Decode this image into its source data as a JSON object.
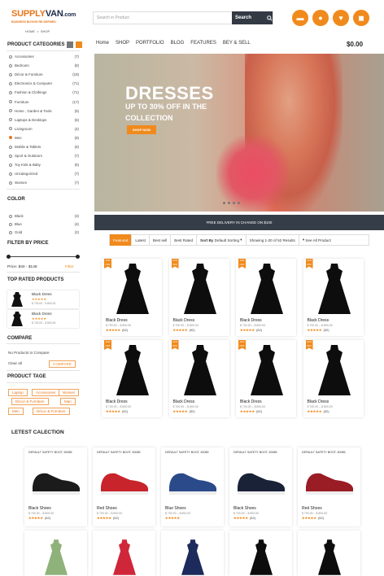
{
  "brand": {
    "name_a": "SUPPLY",
    "name_b": "VAN",
    "tld": ".com",
    "tagline": "BUSINESS BUYING RE-DEFINED"
  },
  "breadcrumb": {
    "home": "HOME",
    "sep": ">",
    "current": "SHOP"
  },
  "search": {
    "placeholder": "Search in Product",
    "button": "Search"
  },
  "nav": {
    "items": [
      "Home",
      "SHOP",
      "PORTFOLIO",
      "BLOG",
      "FEATURES",
      "BEY & SELL"
    ],
    "cart": "$0.00"
  },
  "sidebar": {
    "categories_title": "PRODUCT CATEGORIES",
    "categories": [
      {
        "label": "Accessories",
        "count": "(7)"
      },
      {
        "label": "Bedroom",
        "count": "(8)"
      },
      {
        "label": "Décor & Furniture",
        "count": "(18)"
      },
      {
        "label": "Electronics & Computer",
        "count": "(71)"
      },
      {
        "label": "Fashion & Clothings",
        "count": "(71)"
      },
      {
        "label": "Furniture",
        "count": "(17)"
      },
      {
        "label": "Home , Garden & Tools",
        "count": "(5)"
      },
      {
        "label": "Laptops & Desktops",
        "count": "(6)"
      },
      {
        "label": "Livingroom",
        "count": "(4)"
      },
      {
        "label": "Men",
        "count": "(8)"
      },
      {
        "label": "Mobile & Tablets",
        "count": "(6)"
      },
      {
        "label": "Sport & Outdoors",
        "count": "(7)"
      },
      {
        "label": "Toy Kids & Baby",
        "count": "(6)"
      },
      {
        "label": "Uncategorized",
        "count": "(7)"
      },
      {
        "label": "Women",
        "count": "(7)"
      }
    ],
    "color_title": "COLOR",
    "colors": [
      {
        "label": "Black",
        "count": "(3)"
      },
      {
        "label": "Blue",
        "count": "(4)"
      },
      {
        "label": "Gold",
        "count": "(2)"
      }
    ],
    "price_title": "FILTER BY PRICE",
    "price_range": "Price: $40 - $148",
    "filter_btn": "Filter",
    "top_rated_title": "TOP RATED PRODUCTS",
    "top_rated": [
      {
        "name": "Black Dress",
        "stars": "★★★★★",
        "price": "$ 700.00 - $ 800.00"
      },
      {
        "name": "Black Dress",
        "stars": "★★★★★",
        "price": "$ 700.00 - $ 800.00"
      }
    ],
    "compare_title": "COMPARE",
    "compare_empty": "No Products to Compare",
    "clear_all": "Clear all",
    "compare_btn": "COMPARE",
    "tags_title": "PRODUCT TAGE",
    "tags": [
      "Laptop",
      "Accessories",
      "Women",
      "Décor & Furniture",
      "Man",
      "Men",
      "Décor & Furniture"
    ]
  },
  "hero": {
    "title": "DRESSES",
    "line1": "UP TO 30% OFF IN THE",
    "line2": "COLLECTION",
    "button": "SHOP NOW"
  },
  "banner": "FREE DELIVERY IN CHANGE ON $100",
  "sortbar": {
    "tabs": [
      "Featured",
      "Latest",
      "Best sell",
      "Best Rated"
    ],
    "sort_label": "Sort By",
    "sort_value": "Default Sorting",
    "results": "Showing 1-20 of 52 Results",
    "see_all": "See All Product"
  },
  "products": [
    {
      "badge": "12% OFF",
      "name": "Black Dress",
      "price": "$ 700.00 – $ 800.00",
      "stars": "★★★★★",
      "reviews": "(52)"
    },
    {
      "badge": "12% OFF",
      "name": "Black Dress",
      "price": "$ 700.00 – $ 800.00",
      "stars": "★★★★★",
      "reviews": "(52)"
    },
    {
      "badge": "12% OFF",
      "name": "Black Dress",
      "price": "$ 700.00 – $ 800.00",
      "stars": "★★★★★",
      "reviews": "(52)"
    },
    {
      "badge": "12% OFF",
      "name": "Black Dress",
      "price": "$ 700.00 – $ 800.00",
      "stars": "★★★★★",
      "reviews": "(52)"
    },
    {
      "badge": "12% OFF",
      "name": "Black Dress",
      "price": "$ 700.00 – $ 800.00",
      "stars": "★★★★★",
      "reviews": "(52)"
    },
    {
      "badge": "12% OFF",
      "name": "Black Dress",
      "price": "$ 700.00 – $ 800.00",
      "stars": "★★★★★",
      "reviews": "(52)"
    },
    {
      "badge": "12% OFF",
      "name": "Black Dress",
      "price": "$ 700.00 – $ 800.00",
      "stars": "★★★★★",
      "reviews": "(52)"
    },
    {
      "badge": "12% OFF",
      "name": "Black Dress",
      "price": "$ 700.00 – $ 800.00",
      "stars": "★★★★★",
      "reviews": "(52)"
    }
  ],
  "latest_title": "LETEST CALECTION",
  "latest": [
    {
      "title": "DEFAULT SAFETY BOOT, 50085",
      "name": "Black Shoes",
      "price": "$ 700.00 – $ 800.00",
      "stars": "★★★★★",
      "reviews": "(52)",
      "color": "#1b1b1b"
    },
    {
      "title": "DEFAULT SAFETY BOOT, 50085",
      "name": "Red Shoes",
      "price": "$ 700.00 – $ 800.00",
      "stars": "★★★★★",
      "reviews": "(52)",
      "color": "#c8242b"
    },
    {
      "title": "DEFAULT SAFETY BOOT, 50085",
      "name": "Blue Shoes",
      "price": "$ 700.00 – $ 800.00",
      "stars": "★★★★★",
      "reviews": "",
      "color": "#2a4a8a"
    },
    {
      "title": "DEFAULT SAFETY BOOT, 50085",
      "name": "Black Shoes",
      "price": "$ 700.00 – $ 800.00",
      "stars": "★★★★★",
      "reviews": "(52)",
      "color": "#1a2238"
    },
    {
      "title": "DEFAULT SAFETY BOOT, 50085",
      "name": "Red Shoes",
      "price": "$ 700.00 – $ 800.00",
      "stars": "★★★★★",
      "reviews": "(52)",
      "color": "#9a1c24"
    }
  ]
}
